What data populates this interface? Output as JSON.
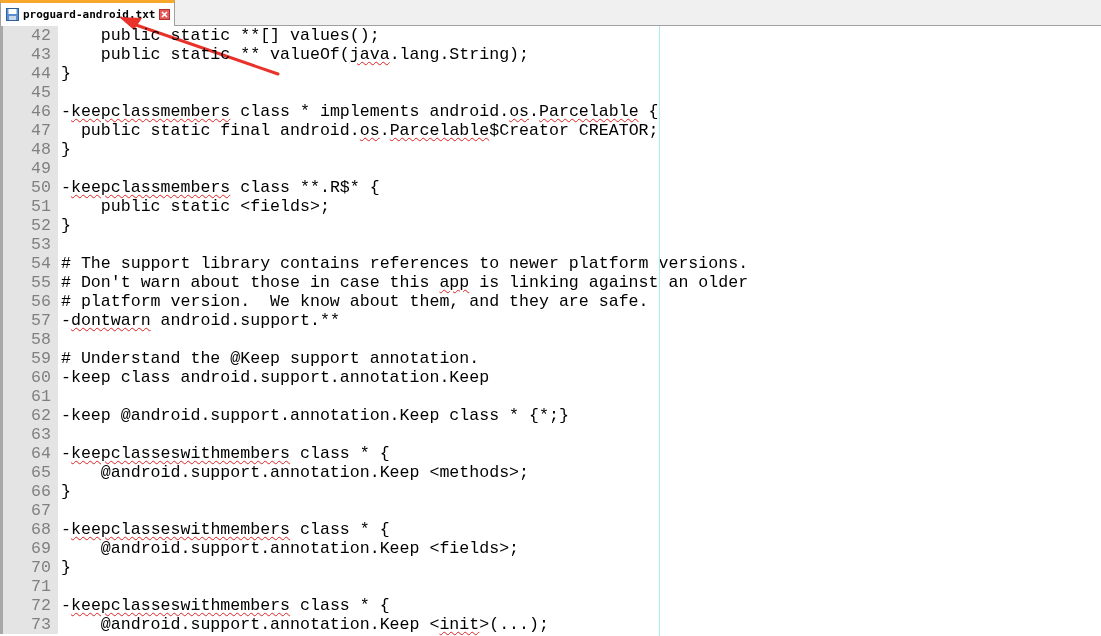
{
  "tabs": [
    {
      "label": "proguard-android.txt",
      "selected": true
    }
  ],
  "annotation": {
    "kind": "arrow"
  },
  "lines": [
    {
      "number": "42",
      "segments": [
        {
          "text": "    public static **[] values();",
          "misspelled": false
        }
      ]
    },
    {
      "number": "43",
      "segments": [
        {
          "text": "    public static ** valueOf(",
          "misspelled": false
        },
        {
          "text": "java",
          "misspelled": true
        },
        {
          "text": ".lang.String);",
          "misspelled": false
        }
      ]
    },
    {
      "number": "44",
      "segments": [
        {
          "text": "}",
          "misspelled": false
        }
      ]
    },
    {
      "number": "45"
    },
    {
      "number": "46",
      "segments": [
        {
          "text": "-",
          "misspelled": false
        },
        {
          "text": "keepclassmembers",
          "misspelled": true
        },
        {
          "text": " class * implements android.",
          "misspelled": false
        },
        {
          "text": "os",
          "misspelled": true
        },
        {
          "text": ".",
          "misspelled": false
        },
        {
          "text": "Parcelable",
          "misspelled": true
        },
        {
          "text": " {",
          "misspelled": false
        }
      ]
    },
    {
      "number": "47",
      "segments": [
        {
          "text": "  public static final android.",
          "misspelled": false
        },
        {
          "text": "os",
          "misspelled": true
        },
        {
          "text": ".",
          "misspelled": false
        },
        {
          "text": "Parcelable",
          "misspelled": true
        },
        {
          "text": "$Creator CREATOR;",
          "misspelled": false
        }
      ]
    },
    {
      "number": "48",
      "segments": [
        {
          "text": "}",
          "misspelled": false
        }
      ]
    },
    {
      "number": "49"
    },
    {
      "number": "50",
      "segments": [
        {
          "text": "-",
          "misspelled": false
        },
        {
          "text": "keepclassmembers",
          "misspelled": true
        },
        {
          "text": " class **.R$* {",
          "misspelled": false
        }
      ]
    },
    {
      "number": "51",
      "segments": [
        {
          "text": "    public static <fields>;",
          "misspelled": false
        }
      ]
    },
    {
      "number": "52",
      "segments": [
        {
          "text": "}",
          "misspelled": false
        }
      ]
    },
    {
      "number": "53"
    },
    {
      "number": "54",
      "segments": [
        {
          "text": "# The support library contains references to newer platform versions.",
          "misspelled": false
        }
      ]
    },
    {
      "number": "55",
      "segments": [
        {
          "text": "# Don't warn about those in case this ",
          "misspelled": false
        },
        {
          "text": "app",
          "misspelled": true
        },
        {
          "text": " is linking against an older",
          "misspelled": false
        }
      ]
    },
    {
      "number": "56",
      "segments": [
        {
          "text": "# platform version.  We know about them, and they are safe.",
          "misspelled": false
        }
      ]
    },
    {
      "number": "57",
      "segments": [
        {
          "text": "-",
          "misspelled": false
        },
        {
          "text": "dontwarn",
          "misspelled": true
        },
        {
          "text": " android.support.**",
          "misspelled": false
        }
      ]
    },
    {
      "number": "58"
    },
    {
      "number": "59",
      "segments": [
        {
          "text": "# Understand the @Keep support annotation.",
          "misspelled": false
        }
      ]
    },
    {
      "number": "60",
      "segments": [
        {
          "text": "-keep class android.support.annotation.Keep",
          "misspelled": false
        }
      ]
    },
    {
      "number": "61"
    },
    {
      "number": "62",
      "segments": [
        {
          "text": "-keep @android.support.annotation.Keep class * {*;}",
          "misspelled": false
        }
      ]
    },
    {
      "number": "63"
    },
    {
      "number": "64",
      "segments": [
        {
          "text": "-",
          "misspelled": false
        },
        {
          "text": "keepclasseswithmembers",
          "misspelled": true
        },
        {
          "text": " class * {",
          "misspelled": false
        }
      ]
    },
    {
      "number": "65",
      "segments": [
        {
          "text": "    @android.support.annotation.Keep <methods>;",
          "misspelled": false
        }
      ]
    },
    {
      "number": "66",
      "segments": [
        {
          "text": "}",
          "misspelled": false
        }
      ]
    },
    {
      "number": "67"
    },
    {
      "number": "68",
      "segments": [
        {
          "text": "-",
          "misspelled": false
        },
        {
          "text": "keepclasseswithmembers",
          "misspelled": true
        },
        {
          "text": " class * {",
          "misspelled": false
        }
      ]
    },
    {
      "number": "69",
      "segments": [
        {
          "text": "    @android.support.annotation.Keep <fields>;",
          "misspelled": false
        }
      ]
    },
    {
      "number": "70",
      "segments": [
        {
          "text": "}",
          "misspelled": false
        }
      ]
    },
    {
      "number": "71"
    },
    {
      "number": "72",
      "segments": [
        {
          "text": "-",
          "misspelled": false
        },
        {
          "text": "keepclasseswithmembers",
          "misspelled": true
        },
        {
          "text": " class * {",
          "misspelled": false
        }
      ]
    },
    {
      "number": "73",
      "segments": [
        {
          "text": "    @android.support.annotation.Keep <",
          "misspelled": false
        },
        {
          "text": "init",
          "misspelled": true
        },
        {
          "text": ">(...);",
          "misspelled": false
        }
      ]
    }
  ]
}
